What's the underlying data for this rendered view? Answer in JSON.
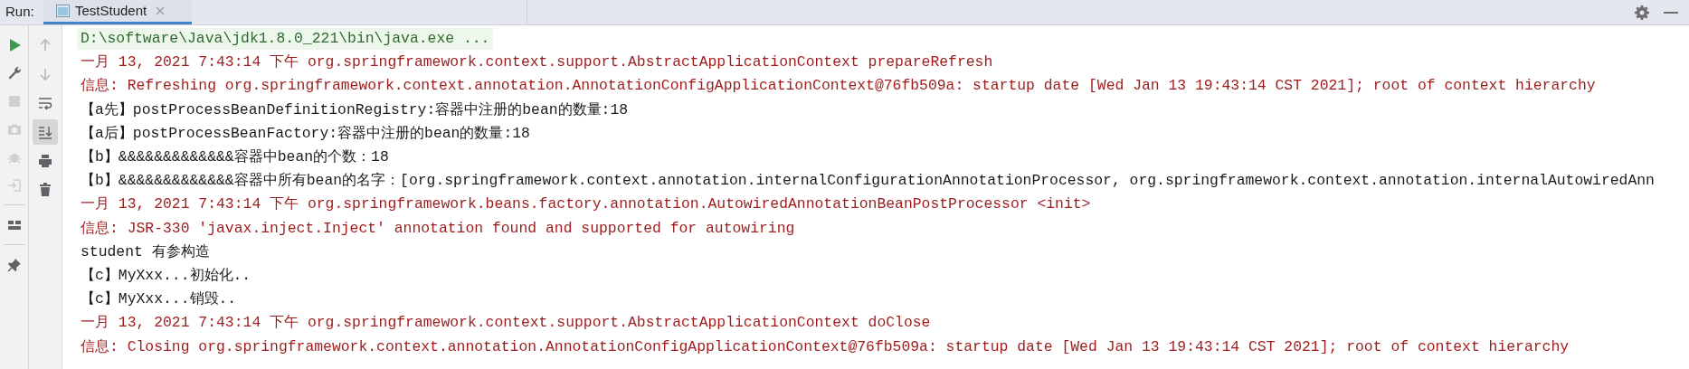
{
  "header": {
    "label": "Run:",
    "tabs": [
      {
        "title": "TestStudent",
        "selected": true
      }
    ]
  },
  "left_toolbar": [
    {
      "kind": "run",
      "disabled": false
    },
    {
      "kind": "wrench",
      "disabled": false
    },
    {
      "kind": "stop",
      "disabled": true
    },
    {
      "kind": "camera",
      "disabled": true
    },
    {
      "kind": "bug",
      "disabled": true
    },
    {
      "kind": "enter",
      "disabled": true
    },
    {
      "kind": "layout",
      "disabled": false
    },
    {
      "kind": "pin",
      "disabled": false
    }
  ],
  "output_toolbar": [
    {
      "kind": "up",
      "selected": false
    },
    {
      "kind": "down",
      "selected": false
    },
    {
      "kind": "wrap",
      "selected": false
    },
    {
      "kind": "scroll_end",
      "selected": true
    },
    {
      "kind": "print",
      "selected": false
    },
    {
      "kind": "trash",
      "selected": false
    }
  ],
  "console_lines": [
    {
      "kind": "command",
      "text": "D:\\software\\Java\\jdk1.8.0_221\\bin\\java.exe ..."
    },
    {
      "kind": "error",
      "text": "一月 13, 2021 7:43:14 下午 org.springframework.context.support.AbstractApplicationContext prepareRefresh"
    },
    {
      "kind": "error",
      "text": "信息: Refreshing org.springframework.context.annotation.AnnotationConfigApplicationContext@76fb509a: startup date [Wed Jan 13 19:43:14 CST 2021]; root of context hierarchy"
    },
    {
      "kind": "output",
      "text": "【a先】postProcessBeanDefinitionRegistry:容器中注册的bean的数量:18"
    },
    {
      "kind": "output",
      "text": "【a后】postProcessBeanFactory:容器中注册的bean的数量:18"
    },
    {
      "kind": "output",
      "text": "【b】&&&&&&&&&&&&&容器中bean的个数：18"
    },
    {
      "kind": "output",
      "text": "【b】&&&&&&&&&&&&&容器中所有bean的名字：[org.springframework.context.annotation.internalConfigurationAnnotationProcessor, org.springframework.context.annotation.internalAutowiredAnn"
    },
    {
      "kind": "error",
      "text": "一月 13, 2021 7:43:14 下午 org.springframework.beans.factory.annotation.AutowiredAnnotationBeanPostProcessor <init>"
    },
    {
      "kind": "error",
      "text": "信息: JSR-330 'javax.inject.Inject' annotation found and supported for autowiring"
    },
    {
      "kind": "output",
      "text": "student 有参构造"
    },
    {
      "kind": "output",
      "text": "【c】MyXxx...初始化.."
    },
    {
      "kind": "output",
      "text": "【c】MyXxx...销毁.."
    },
    {
      "kind": "error",
      "text": "一月 13, 2021 7:43:14 下午 org.springframework.context.support.AbstractApplicationContext doClose"
    },
    {
      "kind": "error",
      "text": "信息: Closing org.springframework.context.annotation.AnnotationConfigApplicationContext@76fb509a: startup date [Wed Jan 13 19:43:14 CST 2021]; root of context hierarchy"
    }
  ]
}
